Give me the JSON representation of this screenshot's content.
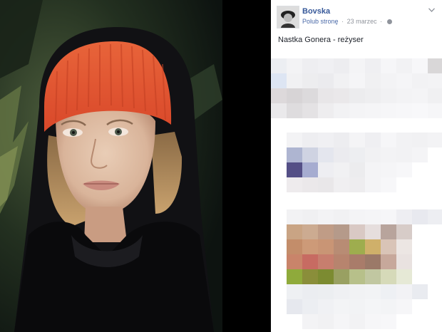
{
  "post": {
    "author": "Bovska",
    "like_page_label": "Polub stronę",
    "separator": "·",
    "date": "23 marzec",
    "text": "Nastka Gonera - reżyser"
  },
  "icons": {
    "menu": "chevron-down-icon",
    "privacy": "globe-icon"
  },
  "colors": {
    "link": "#365899",
    "meta": "#90949c",
    "background_photo": "#000000",
    "beanie": "#e2552f"
  }
}
